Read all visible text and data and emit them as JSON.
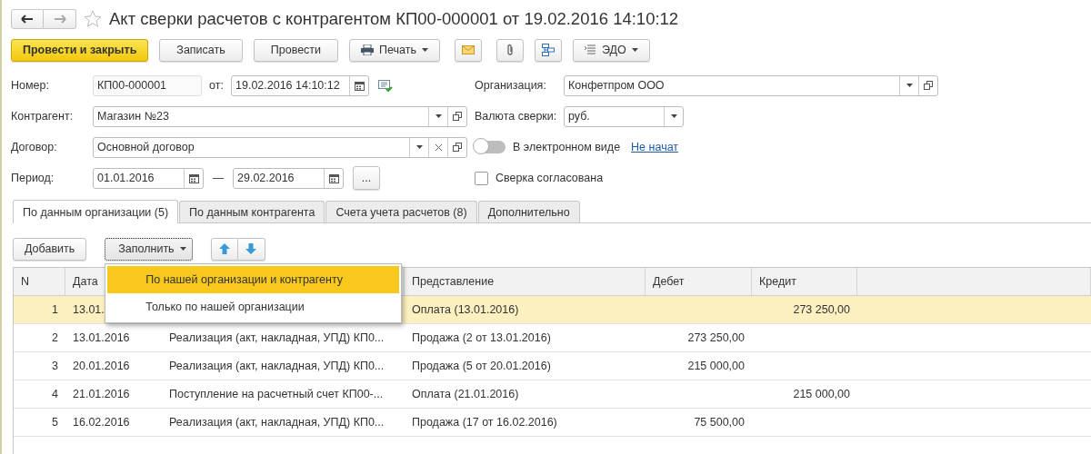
{
  "window": {
    "title": "Акт сверки расчетов с контрагентом КП00-000001 от 19.02.2016 14:10:12",
    "favorite": false
  },
  "toolbar": [
    {
      "kind": "primary",
      "label": "Провести и закрыть"
    },
    {
      "kind": "plain",
      "label": "Записать"
    },
    {
      "kind": "plain",
      "label": "Провести"
    },
    {
      "kind": "print",
      "label": "Печать"
    },
    {
      "kind": "envelope"
    },
    {
      "kind": "paperclip"
    },
    {
      "kind": "structure"
    },
    {
      "kind": "edo",
      "label": "ЭДО"
    }
  ],
  "form": {
    "number": {
      "label": "Номер:",
      "value": "КП00-000001"
    },
    "date": {
      "label": "от:",
      "value": "19.02.2016 14:10:12"
    },
    "organization": {
      "label": "Организация:",
      "value": "Конфетпром ООО"
    },
    "counterparty": {
      "label": "Контрагент:",
      "value": "Магазин №23"
    },
    "currency": {
      "label": "Валюта сверки:",
      "value": "руб."
    },
    "contract": {
      "label": "Договор:",
      "value": "Основной договор"
    },
    "electronic": {
      "label": "В электронном виде",
      "on": false,
      "status_link": "Не начат"
    },
    "period": {
      "label": "Период:",
      "start": "01.01.2016",
      "separator": "—",
      "end": "29.02.2016",
      "more": "..."
    },
    "agreed": {
      "label": "Сверка согласована",
      "checked": false
    }
  },
  "tabs": [
    {
      "label": "По данным организации (5)",
      "selected": true
    },
    {
      "label": "По данным контрагента",
      "selected": false
    },
    {
      "label": "Счета учета расчетов (8)",
      "selected": false
    },
    {
      "label": "Дополнительно",
      "selected": false
    }
  ],
  "table_toolbar": {
    "add": "Добавить",
    "fill": "Заполнить",
    "fill_open": true
  },
  "fill_menu": [
    {
      "label": "По нашей организации и контрагенту",
      "selected": true
    },
    {
      "label": "Только по нашей организации",
      "selected": false
    }
  ],
  "table": {
    "columns": [
      "N",
      "Дата",
      "",
      "Представление",
      "Дебет",
      "Кредит"
    ],
    "rows": [
      {
        "selected": true,
        "cells": [
          "1",
          "13.01.",
          "",
          "Оплата (13.01.2016)",
          "",
          "273 250,00"
        ]
      },
      {
        "selected": false,
        "cells": [
          "2",
          "13.01.2016",
          "Реализация (акт, накладная, УПД) КП0...",
          "Продажа (2 от 13.01.2016)",
          "273 250,00",
          ""
        ]
      },
      {
        "selected": false,
        "cells": [
          "3",
          "20.01.2016",
          "Реализация (акт, накладная, УПД) КП0...",
          "Продажа (5 от 20.01.2016)",
          "215 000,00",
          ""
        ]
      },
      {
        "selected": false,
        "cells": [
          "4",
          "21.01.2016",
          "Поступление на расчетный счет КП00-...",
          "Оплата (21.01.2016)",
          "",
          "215 000,00"
        ]
      },
      {
        "selected": false,
        "cells": [
          "5",
          "16.02.2016",
          "Реализация (акт, накладная, УПД) КП0...",
          "Продажа (17 от 16.02.2016)",
          "75 500,00",
          ""
        ]
      }
    ]
  }
}
